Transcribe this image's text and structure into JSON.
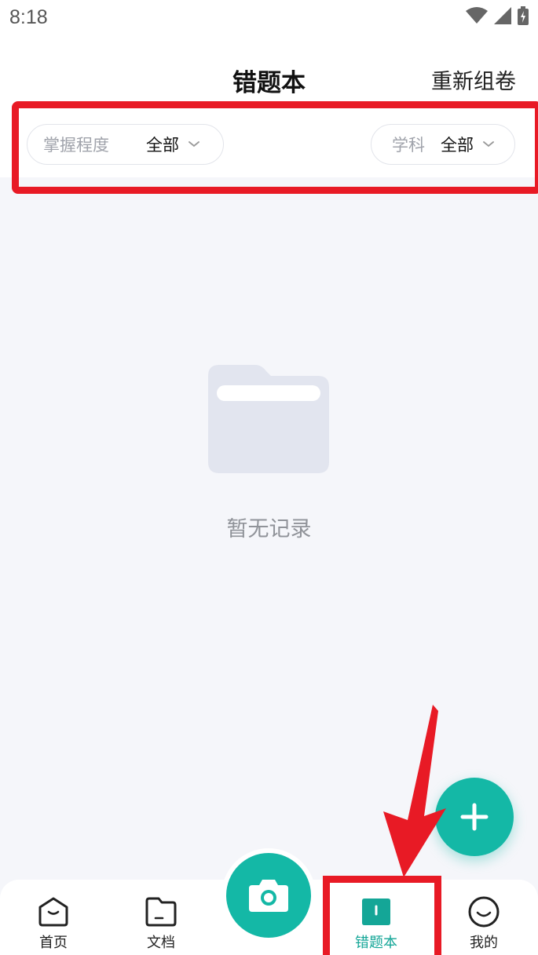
{
  "status_bar": {
    "time": "8:18",
    "icons": [
      "wifi-icon",
      "signal-icon",
      "battery-charging-icon"
    ]
  },
  "header": {
    "title": "错题本",
    "right_action": "重新组卷"
  },
  "filters": {
    "mastery": {
      "label": "掌握程度",
      "value": "全部"
    },
    "subject": {
      "label": "学科",
      "value": "全部"
    }
  },
  "empty_state": {
    "icon": "folder-icon",
    "text": "暂无记录"
  },
  "fab": {
    "icon": "plus-icon"
  },
  "tabbar": {
    "items": [
      {
        "label": "首页",
        "icon": "home-icon"
      },
      {
        "label": "文档",
        "icon": "document-folder-icon"
      },
      {
        "label": "",
        "icon": "camera-icon"
      },
      {
        "label": "错题本",
        "icon": "book-icon",
        "active": true
      },
      {
        "label": "我的",
        "icon": "smile-profile-icon"
      }
    ]
  },
  "colors": {
    "accent": "#14b8a6",
    "highlight": "#e81a25",
    "background": "#f5f6fa"
  }
}
